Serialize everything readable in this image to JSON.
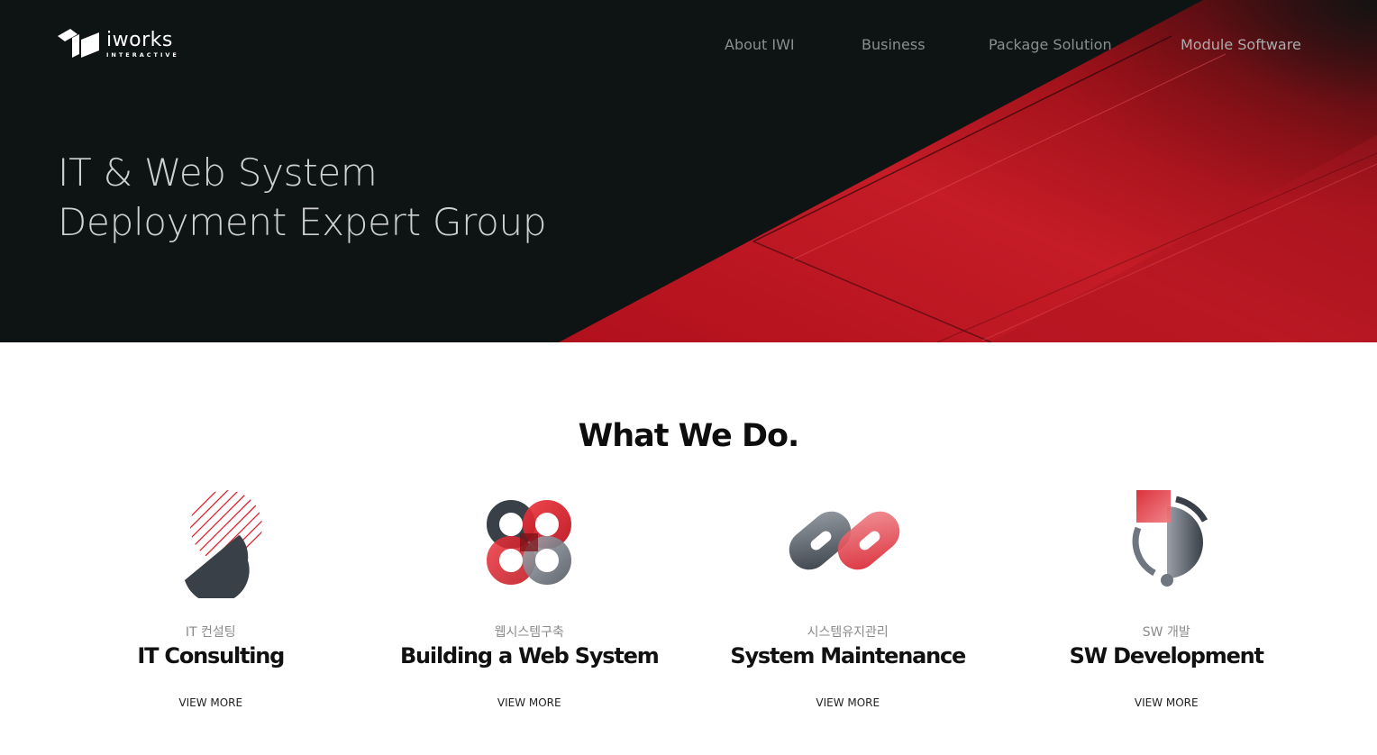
{
  "brand": {
    "name": "iworks",
    "sub": "INTERACTIVE"
  },
  "nav": [
    {
      "label": "About IWI"
    },
    {
      "label": "Business"
    },
    {
      "label": "Package Solution"
    },
    {
      "label": "Module Software"
    }
  ],
  "hero": {
    "line1": "IT & Web System",
    "line2": "Deployment Expert Group"
  },
  "section": {
    "title": "What We Do."
  },
  "services": [
    {
      "kr": "IT 컨설팅",
      "title": "IT Consulting",
      "link": "VIEW MORE",
      "icon": "consulting-icon"
    },
    {
      "kr": "웹시스템구축",
      "title": "Building a Web System",
      "link": "VIEW MORE",
      "icon": "web-system-icon"
    },
    {
      "kr": "시스템유지관리",
      "title": "System Maintenance",
      "link": "VIEW MORE",
      "icon": "maintenance-icon"
    },
    {
      "kr": "SW 개발",
      "title": "SW Development",
      "link": "VIEW MORE",
      "icon": "sw-development-icon"
    }
  ],
  "colors": {
    "accent": "#d8202c",
    "dark": "#0e1413",
    "slate": "#3a4048"
  }
}
